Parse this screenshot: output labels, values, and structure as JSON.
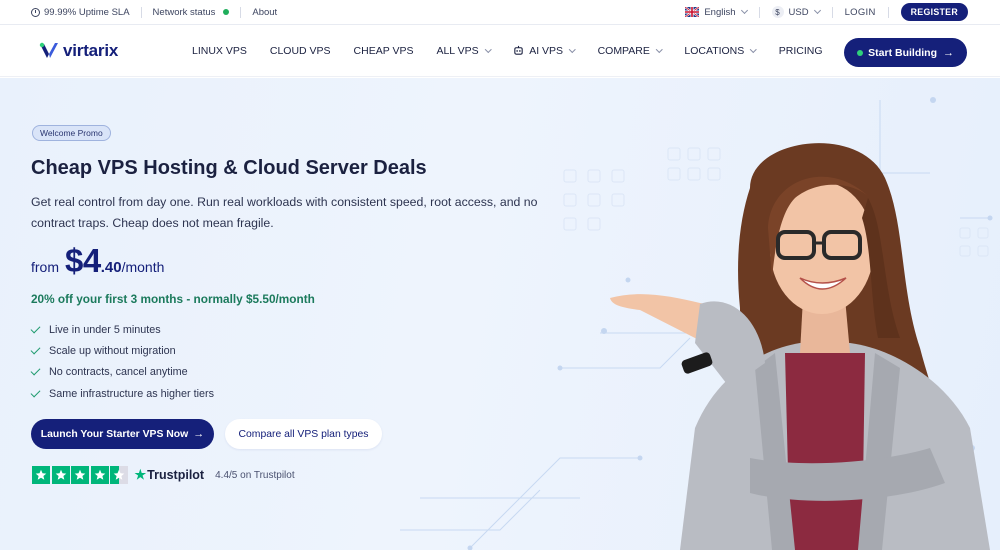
{
  "topbar": {
    "uptime": "99.99% Uptime SLA",
    "network_status": "Network status",
    "about": "About",
    "language": "English",
    "currency": "USD",
    "login": "LOGIN",
    "register": "REGISTER",
    "status_color": "#1fae5b"
  },
  "nav": {
    "logo_text": "virtarix",
    "items": [
      {
        "label": "LINUX VPS"
      },
      {
        "label": "CLOUD VPS"
      },
      {
        "label": "CHEAP VPS"
      },
      {
        "label": "ALL VPS"
      },
      {
        "label": "AI VPS"
      },
      {
        "label": "COMPARE"
      },
      {
        "label": "LOCATIONS"
      },
      {
        "label": "PRICING"
      }
    ],
    "cta": "Start Building"
  },
  "hero": {
    "promo_badge": "Welcome Promo",
    "title": "Cheap VPS Hosting & Cloud Server Deals",
    "description": "Get real control from day one. Run real workloads with consistent speed, root access, and no contract traps. Cheap does not mean fragile.",
    "price": {
      "from": "from",
      "amount": "$4",
      "cents": ".40",
      "period": "/month"
    },
    "discount": "20% off your first 3 months - normally $5.50/month",
    "features": [
      "Live in under 5 minutes",
      "Scale up without migration",
      "No contracts, cancel anytime",
      "Same infrastructure as higher tiers"
    ],
    "primary_button": "Launch Your Starter VPS Now",
    "secondary_button": "Compare all VPS plan types",
    "trustpilot": {
      "brand": "Trustpilot",
      "rating_text": "4.4/5 on Trustpilot",
      "stars": 4.5
    }
  },
  "colors": {
    "brand": "#15207a",
    "discount": "#1b7a5c",
    "check": "#1f9b6e",
    "trustpilot": "#00b67a"
  }
}
